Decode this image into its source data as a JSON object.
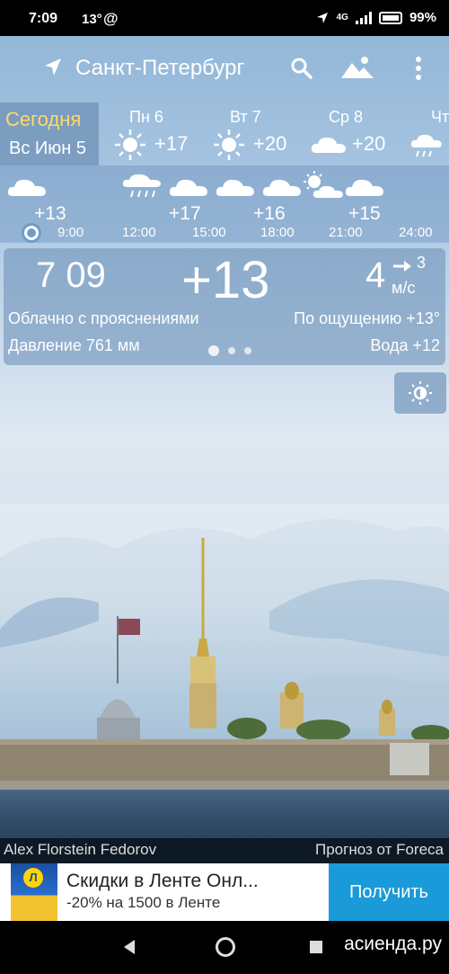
{
  "statusbar": {
    "time": "7:09",
    "temp": "13°",
    "at": "@",
    "battery": "99%",
    "network": "4G"
  },
  "header": {
    "city": "Санкт-Петербург"
  },
  "days": {
    "today": {
      "label": "Сегодня",
      "date": "Вс Июн 5"
    },
    "list": [
      {
        "name": "Пн 6",
        "temp": "+17",
        "icon": "sun-icon"
      },
      {
        "name": "Вт 7",
        "temp": "+20",
        "icon": "sun-icon"
      },
      {
        "name": "Ср 8",
        "temp": "+20",
        "icon": "cloud-icon"
      },
      {
        "name": "Чт",
        "temp": "",
        "icon": "rain-icon"
      }
    ]
  },
  "hours": [
    {
      "time": "9:00",
      "temp": "+13",
      "icon": "cloud-icon"
    },
    {
      "time": "12:00",
      "temp": "",
      "icon": "rain-icon"
    },
    {
      "time": "15:00",
      "temp": "+17",
      "icon": "cloud-icon"
    },
    {
      "time": "18:00",
      "temp": "+16",
      "icon": "cloud-icon"
    },
    {
      "time": "21:00",
      "temp": "",
      "icon": "cloud-icon"
    },
    {
      "time": "24:00",
      "temp": "+15",
      "icon": "cloud-icon"
    }
  ],
  "current": {
    "time": "7 09",
    "temp": "+13",
    "wind": "4",
    "gust": "3",
    "wind_unit": "м/с",
    "condition": "Облачно с прояснениями",
    "feels_like": "По ощущению +13°",
    "pressure": "Давление 761 мм",
    "water": "Вода +12"
  },
  "credits": {
    "author": "Alex Florstein Fedorov",
    "source": "Прогноз от Foreca"
  },
  "ad": {
    "title": "Скидки в Ленте Онл...",
    "subtitle": "-20% на 1500 в Ленте",
    "button": "Получить",
    "logo_text": "Л"
  },
  "watermark": "асиенда.ру",
  "colors": {
    "today_label": "#ffd966",
    "ad_button": "#1a9ad9",
    "panel": "#7396bc"
  }
}
